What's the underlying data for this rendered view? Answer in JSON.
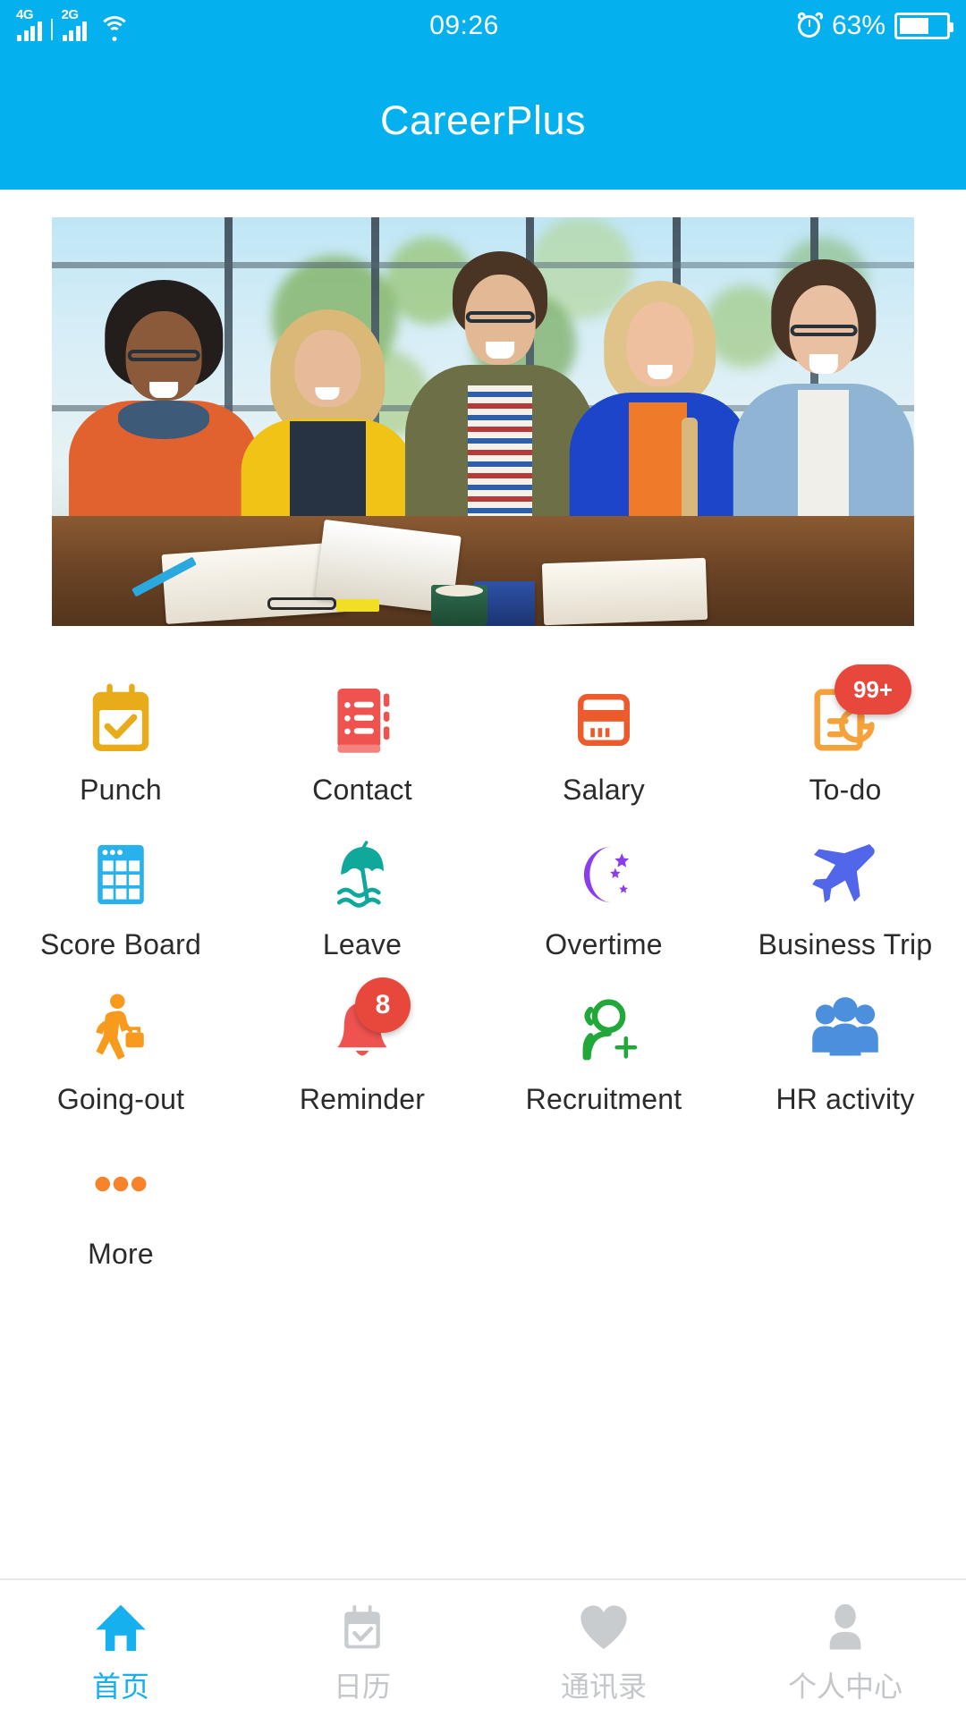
{
  "status_bar": {
    "network_1": "4G",
    "network_2": "2G",
    "wifi_icon": "wifi-icon",
    "time": "09:26",
    "alarm_icon": "alarm-clock-icon",
    "battery_percent": "63%",
    "battery_level": 63
  },
  "header": {
    "title": "CareerPlus",
    "background_color": "#05b0ee"
  },
  "banner": {
    "alt": "Five smiling young colleagues sitting at a table with open books in front of large office windows",
    "name": "hero-banner"
  },
  "grid": {
    "items": [
      {
        "id": "punch",
        "label": "Punch",
        "icon": "calendar-check-icon",
        "color": "#e8ac1a",
        "badge": null
      },
      {
        "id": "contact",
        "label": "Contact",
        "icon": "address-book-icon",
        "color": "#ef5350",
        "badge": null
      },
      {
        "id": "salary",
        "label": "Salary",
        "icon": "payment-card-icon",
        "color": "#ec5b2b",
        "badge": null
      },
      {
        "id": "todo",
        "label": "To-do",
        "icon": "todo-clock-icon",
        "color": "#f6a23c",
        "badge": "99+",
        "badge_shape": "pill",
        "badge_color": "#e8483c"
      },
      {
        "id": "score-board",
        "label": "Score Board",
        "icon": "table-grid-icon",
        "color": "#28b1ec",
        "badge": null
      },
      {
        "id": "leave",
        "label": "Leave",
        "icon": "beach-umbrella-icon",
        "color": "#10a89b",
        "badge": null
      },
      {
        "id": "overtime",
        "label": "Overtime",
        "icon": "moon-stars-icon",
        "color": "#8b3dee",
        "badge": null
      },
      {
        "id": "business-trip",
        "label": "Business Trip",
        "icon": "airplane-icon",
        "color": "#5166e8",
        "badge": null
      },
      {
        "id": "going-out",
        "label": "Going-out",
        "icon": "walking-person-icon",
        "color": "#f79a1e",
        "badge": null
      },
      {
        "id": "reminder",
        "label": "Reminder",
        "icon": "bell-icon",
        "color": "#ef5350",
        "badge": "8",
        "badge_shape": "circle",
        "badge_color": "#e8483c"
      },
      {
        "id": "recruitment",
        "label": "Recruitment",
        "icon": "person-add-icon",
        "color": "#21a73a",
        "badge": null
      },
      {
        "id": "hr-activity",
        "label": "HR activity",
        "icon": "people-group-icon",
        "color": "#4b8fdd",
        "badge": null
      },
      {
        "id": "more",
        "label": "More",
        "icon": "ellipsis-icon",
        "color": "#f7832a",
        "badge": null
      }
    ]
  },
  "tab_bar": {
    "items": [
      {
        "id": "home",
        "label": "首页",
        "icon": "home-icon",
        "active": true
      },
      {
        "id": "calendar",
        "label": "日历",
        "icon": "calendar-icon",
        "active": false
      },
      {
        "id": "contacts",
        "label": "通讯录",
        "icon": "heart-icon",
        "active": false
      },
      {
        "id": "profile",
        "label": "个人中心",
        "icon": "person-icon",
        "active": false
      }
    ],
    "active_color": "#17b0ef",
    "inactive_color": "#c3c7ca"
  }
}
